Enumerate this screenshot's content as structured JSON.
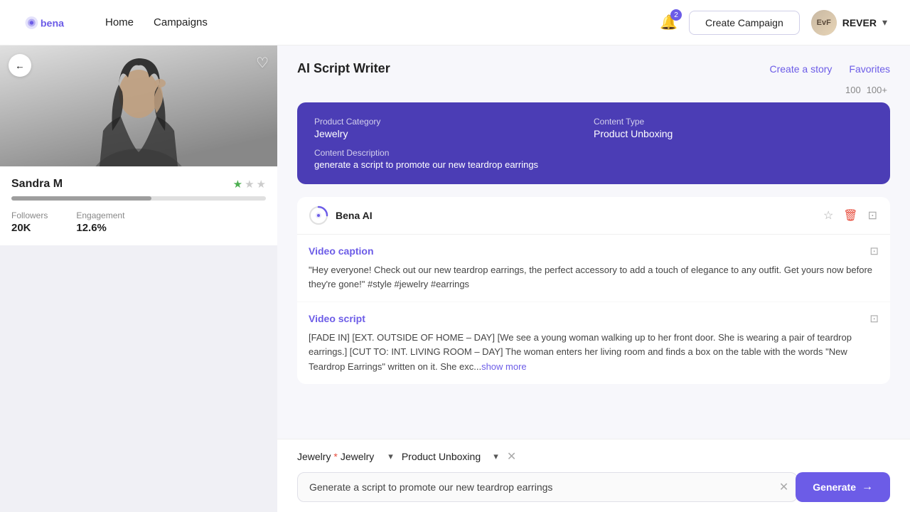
{
  "nav": {
    "logo_text": "bena",
    "links": [
      "Home",
      "Campaigns"
    ],
    "notif_count": "2",
    "create_btn": "Create Campaign",
    "user_name": "REVER",
    "user_initials": "EvF"
  },
  "influencer": {
    "name": "Sandra M",
    "stars_filled": 1,
    "stars_total": 3,
    "followers_label": "Followers",
    "followers_value": "20K",
    "engagement_label": "Engagement",
    "engagement_value": "12.6%",
    "progress_pct": 55
  },
  "script_writer": {
    "title": "AI Script Writer",
    "action_create": "Create a story",
    "action_favorites": "Favorites",
    "pagination_current": "100",
    "pagination_total": "100+"
  },
  "info_card": {
    "product_category_label": "Product Category",
    "product_category_value": "Jewelry",
    "content_type_label": "Content Type",
    "content_type_value": "Product Unboxing",
    "content_desc_label": "Content Description",
    "content_desc_value": "generate a script to promote our new teardrop earrings"
  },
  "ai_response": {
    "ai_name": "Bena AI",
    "caption_title": "Video caption",
    "caption_text": "\"Hey everyone! Check out our new teardrop earrings, the perfect accessory to add a touch of elegance to any outfit. Get yours now before they're gone!\" #style #jewelry #earrings",
    "script_title": "Video script",
    "script_text": "[FADE IN]\n[EXT. OUTSIDE OF HOME – DAY]\n[We see a young woman walking up to her front door. She is wearing a pair of teardrop earrings.]\n[CUT TO: INT. LIVING ROOM – DAY]\nThe woman enters her living room and finds a box on the table with the words \"New Teardrop Earrings\" written on it. She exc...",
    "show_more_label": "show more"
  },
  "bottom_bar": {
    "category_label": "Jewelry",
    "category_required": true,
    "content_type_label": "Product Unboxing",
    "input_value": "Generate a script to promote our new teardrop earrings",
    "generate_label": "Generate"
  }
}
